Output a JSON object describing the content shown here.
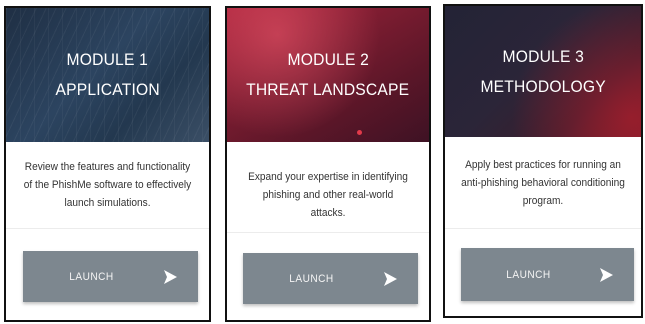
{
  "modules": [
    {
      "title_line1": "MODULE 1",
      "title_line2": "APPLICATION",
      "description": "Review the features and functionality of the PhishMe software to effectively launch simulations.",
      "button_label": "LAUNCH",
      "button_icon": "arrow-right-icon"
    },
    {
      "title_line1": "MODULE 2",
      "title_line2": "THREAT LANDSCAPE",
      "description": "Expand your expertise in identifying phishing and other real-world attacks.",
      "button_label": "LAUNCH",
      "button_icon": "arrow-right-icon"
    },
    {
      "title_line1": "MODULE 3",
      "title_line2": "METHODOLOGY",
      "description": "Apply best practices for running an anti-phishing behavioral conditioning program.",
      "button_label": "LAUNCH",
      "button_icon": "arrow-right-icon"
    }
  ],
  "colors": {
    "button_bg": "#7d878f",
    "button_text": "#f4f4f4",
    "card_border": "#111111",
    "module1_banner": "#2c4460",
    "module2_banner": "#7a1c30",
    "module3_banner": "#2b2538",
    "accent_red": "#e23a4a"
  }
}
